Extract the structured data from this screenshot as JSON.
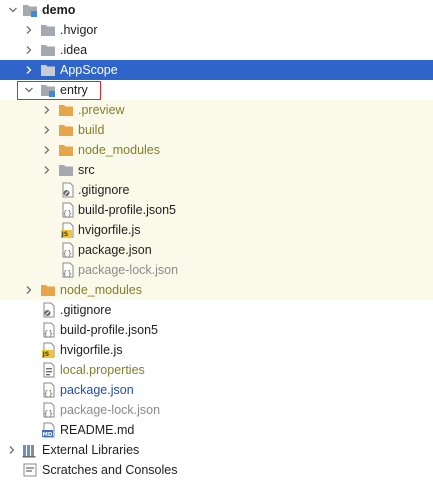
{
  "colors": {
    "selection": "#2f65ca",
    "excluded_background": "#fbfaea",
    "highlight_border": "#e02828",
    "folder": "#a5a8ae",
    "excluded_folder": "#e7a54b",
    "module_blue": "#3e8bd2"
  },
  "tree": {
    "root": {
      "label": "demo",
      "icon": "module-folder-icon",
      "expanded": true
    },
    "hvigor": {
      "label": ".hvigor",
      "icon": "folder-icon"
    },
    "idea": {
      "label": ".idea",
      "icon": "folder-icon"
    },
    "appscope": {
      "label": "AppScope",
      "icon": "folder-icon",
      "selected": true
    },
    "entry": {
      "label": "entry",
      "icon": "module-folder-icon",
      "expanded": true,
      "children": {
        "preview": {
          "label": ".preview",
          "icon": "excluded-folder-icon"
        },
        "build": {
          "label": "build",
          "icon": "excluded-folder-icon"
        },
        "node_modules": {
          "label": "node_modules",
          "icon": "excluded-folder-icon"
        },
        "src": {
          "label": "src",
          "icon": "folder-icon"
        },
        "gitignore": {
          "label": ".gitignore",
          "icon": "gitignore-file-icon"
        },
        "build_profile": {
          "label": "build-profile.json5",
          "icon": "json-file-icon"
        },
        "hvigorfile": {
          "label": "hvigorfile.js",
          "icon": "js-file-icon"
        },
        "package_json": {
          "label": "package.json",
          "icon": "json-file-icon"
        },
        "package_lock": {
          "label": "package-lock.json",
          "icon": "json-file-icon"
        }
      }
    },
    "node_modules": {
      "label": "node_modules",
      "icon": "excluded-folder-icon"
    },
    "gitignore": {
      "label": ".gitignore",
      "icon": "gitignore-file-icon"
    },
    "build_profile": {
      "label": "build-profile.json5",
      "icon": "json-file-icon"
    },
    "hvigorfile": {
      "label": "hvigorfile.js",
      "icon": "js-file-icon"
    },
    "local_properties": {
      "label": "local.properties",
      "icon": "properties-file-icon"
    },
    "package_json": {
      "label": "package.json",
      "icon": "json-file-icon"
    },
    "package_lock": {
      "label": "package-lock.json",
      "icon": "json-file-icon"
    },
    "readme": {
      "label": "README.md",
      "icon": "markdown-file-icon",
      "badge": "MD"
    },
    "external_libraries": {
      "label": "External Libraries",
      "icon": "libraries-icon"
    },
    "scratches": {
      "label": "Scratches and Consoles",
      "icon": "scratches-icon"
    }
  },
  "file_badges": {
    "js": "JS",
    "md": "MD"
  }
}
